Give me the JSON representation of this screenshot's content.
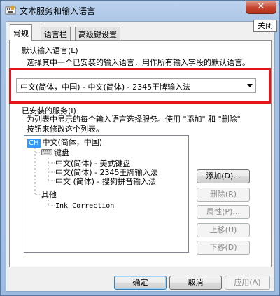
{
  "window": {
    "title": "文本服务和输入语言",
    "close_glyph": "✕",
    "close_tooltip": "关闭"
  },
  "tabs": [
    {
      "label": "常规",
      "active": true
    },
    {
      "label": "语言栏",
      "active": false
    },
    {
      "label": "高级键设置",
      "active": false
    }
  ],
  "default_language": {
    "group_title": "默认输入语言(L)",
    "description": "选择其中一个已安装的输入语言，用作所有输入字段的默认语言。",
    "selected": "中文(简体，中国) - 中文(简体) - 2345王牌输入法"
  },
  "installed_services": {
    "group_title": "已安装的服务(I)",
    "description_line1": "为列表中显示的每个输入语言选择服务。使用 \"添加\" 和 \"删除\"",
    "description_line2": "按钮来修改这个列表。",
    "tree": {
      "language_badge": "CH",
      "language": "中文(简体，中国)",
      "keyboard_group": "键盘",
      "keyboard_items": [
        "中文(简体) - 美式键盘",
        "中文(简体) - 2345王牌输入法",
        "中文 (简体) - 搜狗拼音输入法"
      ],
      "other_group": "其他",
      "other_items": [
        "Ink Correction"
      ]
    },
    "side_buttons": {
      "add": "添加(D)...",
      "remove": "删除(R)",
      "properties": "属性(P)...",
      "move_up": "上移(U)",
      "move_down": "下移(D)"
    }
  },
  "footer": {
    "ok": "确定",
    "cancel": "取消",
    "apply": "应用(A)"
  },
  "colors": {
    "highlight_box": "#e8141b",
    "close_button": "#c6432e",
    "language_badge": "#3399ff"
  }
}
